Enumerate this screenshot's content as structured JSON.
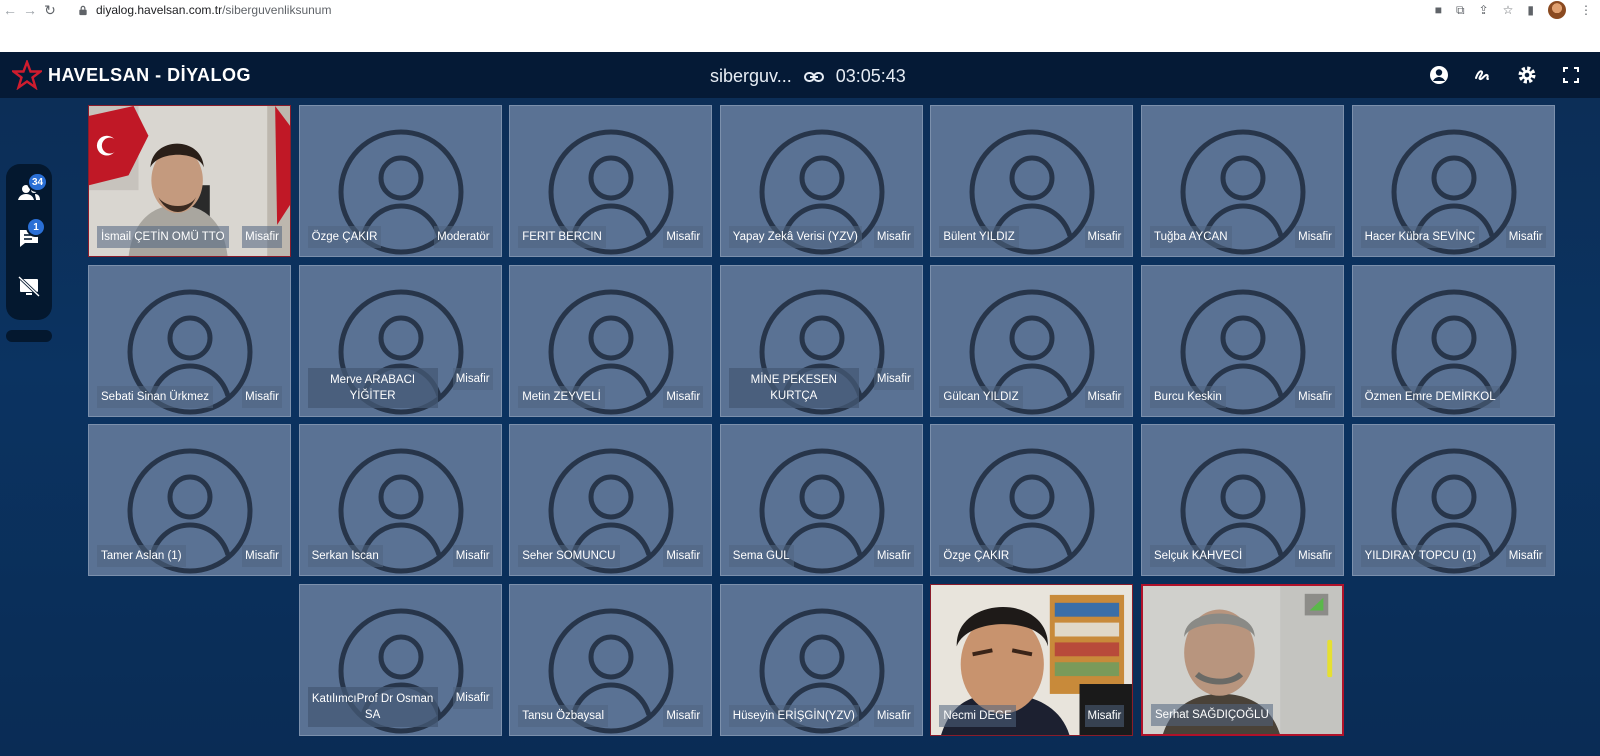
{
  "browser": {
    "url_host": "diyalog.havelsan.com.tr",
    "url_path": "/siberguvenliksunum"
  },
  "app": {
    "logo_text": "HAVELSAN - DİYALOG",
    "meeting_title": "siberguv...",
    "timer": "03:05:43"
  },
  "left_rail": {
    "participants_count": "34",
    "chat_count": "1"
  },
  "tiles": [
    {
      "name": "İsmail ÇETİN OMÜ TTO",
      "role": "Misafir",
      "type": "video1"
    },
    {
      "name": "Özge ÇAKIR",
      "role": "Moderatör",
      "type": "avatar"
    },
    {
      "name": "FERIT BERCIN",
      "role": "Misafir",
      "type": "avatar"
    },
    {
      "name": "Yapay Zekâ Verisi (YZV)",
      "role": "Misafir",
      "type": "avatar"
    },
    {
      "name": "Bülent YILDIZ",
      "role": "Misafir",
      "type": "avatar"
    },
    {
      "name": "Tuğba AYCAN",
      "role": "Misafir",
      "type": "avatar"
    },
    {
      "name": "Hacer Kübra SEVİNÇ",
      "role": "Misafir",
      "type": "avatar"
    },
    {
      "name": "Sebati Sinan Ürkmez",
      "role": "Misafir",
      "type": "avatar"
    },
    {
      "name": "Merve ARABACI YİĞİTER",
      "role": "Misafir",
      "type": "avatar",
      "two_line": true
    },
    {
      "name": "Metin ZEYVELİ",
      "role": "Misafir",
      "type": "avatar"
    },
    {
      "name": "MİNE PEKESEN KURTÇA",
      "role": "Misafir",
      "type": "avatar",
      "two_line": true
    },
    {
      "name": "Gülcan YILDIZ",
      "role": "Misafir",
      "type": "avatar"
    },
    {
      "name": "Burcu Keskin",
      "role": "Misafir",
      "type": "avatar"
    },
    {
      "name": "Özmen Emre DEMİRKOL",
      "role": "",
      "type": "avatar"
    },
    {
      "name": "Tamer Aslan (1)",
      "role": "Misafir",
      "type": "avatar"
    },
    {
      "name": "Serkan Iscan",
      "role": "Misafir",
      "type": "avatar"
    },
    {
      "name": "Seher SOMUNCU",
      "role": "Misafir",
      "type": "avatar"
    },
    {
      "name": "Sema GUL",
      "role": "Misafir",
      "type": "avatar"
    },
    {
      "name": "Özge ÇAKIR",
      "role": "",
      "type": "avatar"
    },
    {
      "name": "Selçuk KAHVECİ",
      "role": "Misafir",
      "type": "avatar"
    },
    {
      "name": "YILDIRAY TOPCU (1)",
      "role": "Misafir",
      "type": "avatar"
    },
    {
      "name": "",
      "role": "",
      "type": "empty"
    },
    {
      "name": "KatılımcıProf Dr Osman SA",
      "role": "Misafir",
      "type": "avatar",
      "two_line": true
    },
    {
      "name": "Tansu Özbaysal",
      "role": "Misafir",
      "type": "avatar"
    },
    {
      "name": "Hüseyin ERİŞGİN(YZV)",
      "role": "Misafir",
      "type": "avatar"
    },
    {
      "name": "Necmi DEGE",
      "role": "Misafir",
      "type": "video2"
    },
    {
      "name": "Serhat SAĞDIÇOĞLU",
      "role": "",
      "type": "video3"
    }
  ]
}
